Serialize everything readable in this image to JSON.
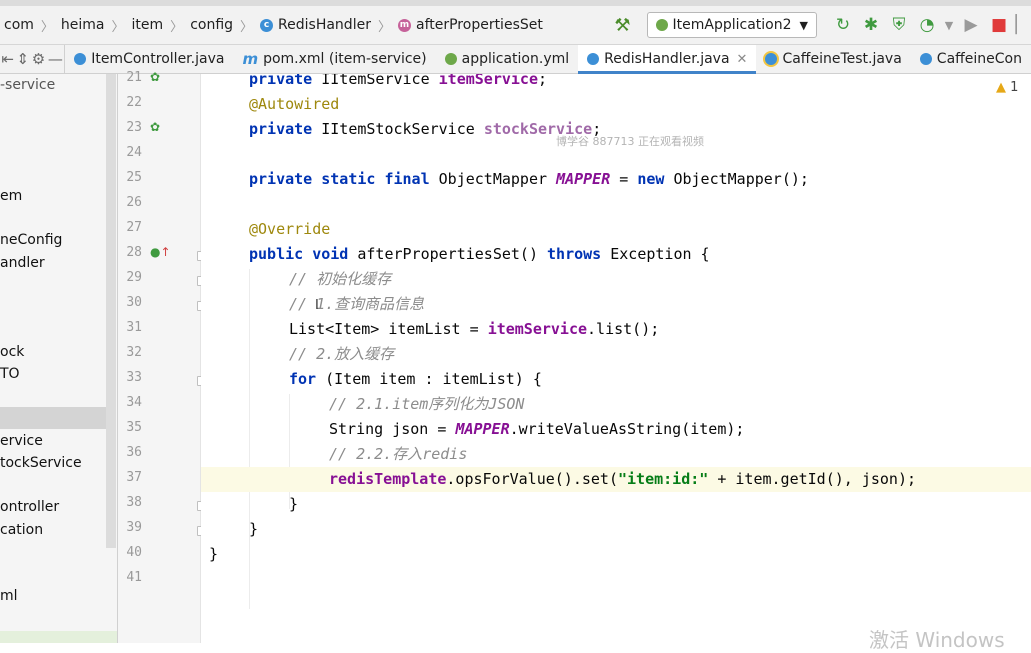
{
  "breadcrumb": [
    "com",
    "heima",
    "item",
    "config",
    "RedisHandler",
    "afterPropertiesSet"
  ],
  "run_config": "ItemApplication2",
  "tabs": [
    {
      "label": "ItemController.java",
      "icon": "class-icon",
      "active": false
    },
    {
      "label": "pom.xml (item-service)",
      "icon": "maven-icon",
      "active": false
    },
    {
      "label": "application.yml",
      "icon": "yaml-icon",
      "active": false
    },
    {
      "label": "RedisHandler.java",
      "icon": "class-icon",
      "active": true
    },
    {
      "label": "CaffeineTest.java",
      "icon": "test-class-icon",
      "active": false
    },
    {
      "label": "CaffeineCon",
      "icon": "class-icon",
      "active": false
    }
  ],
  "project_tree": [
    "-service",
    "em",
    "neConfig",
    "andler",
    "ock",
    "TO",
    "ervice",
    "tockService",
    "ontroller",
    "cation",
    "ml"
  ],
  "line_numbers": [
    "21",
    "22",
    "23",
    "24",
    "25",
    "26",
    "27",
    "28",
    "29",
    "30",
    "31",
    "32",
    "33",
    "34",
    "35",
    "36",
    "37",
    "38",
    "39",
    "40",
    "41"
  ],
  "code": {
    "l21": {
      "kw": "private",
      "type": "IItemService",
      "field": "itemService",
      "end": ";"
    },
    "l22": {
      "ann": "@Autowired"
    },
    "l23": {
      "kw": "private",
      "type": "IItemStockService",
      "field": "stockService",
      "end": ";"
    },
    "l25": {
      "kw": "private static final",
      "type": "ObjectMapper",
      "const": "MAPPER",
      "eq": "=",
      "new": "new",
      "rest": "ObjectMapper();"
    },
    "l27": {
      "ann": "@Override"
    },
    "l28": {
      "kw": "public void",
      "name": "afterPropertiesSet()",
      "throws": "throws",
      "rest": "Exception {"
    },
    "l29": "// 初始化缓存",
    "l30": "// 1.查询商品信息",
    "l31": {
      "pre": "List<Item> itemList = ",
      "field": "itemService",
      "rest": ".list();"
    },
    "l32": "// 2.放入缓存",
    "l33": {
      "kw": "for",
      "rest": "(Item item : itemList) {"
    },
    "l34": "// 2.1.item序列化为JSON",
    "l35": {
      "pre": "String json = ",
      "const": "MAPPER",
      "rest": ".writeValueAsString(item);"
    },
    "l36": "// 2.2.存入redis",
    "l37": {
      "field": "redisTemplate",
      "mid": ".opsForValue().set(",
      "str": "\"item:id:\"",
      "rest": " + item.getId(), json);"
    },
    "l38": "}",
    "l39": "}",
    "l40": "}"
  },
  "warnings": "1",
  "overlay_watermark": "博学谷 887713 正在观看视频",
  "windows_watermark": "激活 Windows"
}
